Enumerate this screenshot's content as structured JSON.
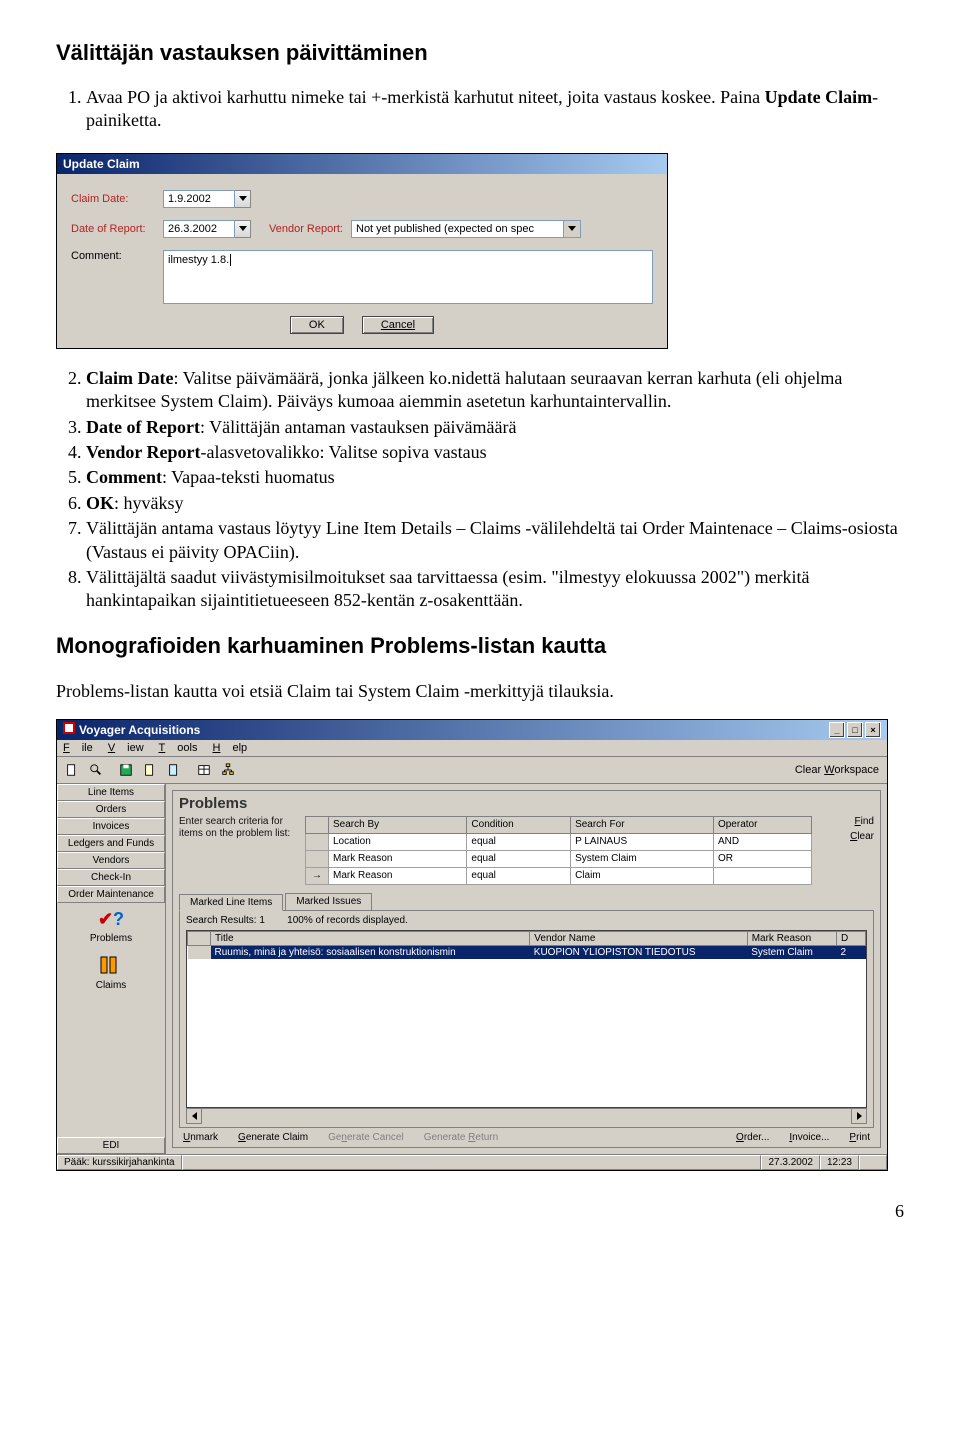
{
  "doc": {
    "heading1": "Välittäjän vastauksen päivittäminen",
    "intro1a": "Avaa PO ja aktivoi karhuttu nimeke tai +-merkistä karhutut niteet, joita vastaus koskee. Paina ",
    "intro1b": "Update Claim",
    "intro1c": "-painiketta.",
    "li2a": "Claim Date",
    "li2b": ": Valitse päivämäärä, jonka jälkeen ko.nidettä halutaan seuraavan kerran karhuta (eli ohjelma merkitsee System Claim). Päiväys kumoaa aiemmin asetetun karhuntaintervallin.",
    "li3a": "Date of Report",
    "li3b": ": Välittäjän antaman vastauksen päivämäärä",
    "li4a": "Vendor Report",
    "li4b": "-alasvetovalikko: Valitse sopiva vastaus",
    "li5a": "Comment",
    "li5b": ": Vapaa-teksti huomatus",
    "li6a": "OK",
    "li6b": ": hyväksy",
    "li7": "Välittäjän antama vastaus löytyy Line Item Details – Claims -välilehdeltä tai Order Maintenace – Claims-osiosta (Vastaus ei päivity OPACiin).",
    "li8": "Välittäjältä saadut viivästymisilmoitukset saa tarvittaessa (esim. \"ilmestyy elokuussa 2002\") merkitä hankintapaikan sijaintitietueeseen 852-kentän z-osakenttään.",
    "heading2": "Monografioiden karhuaminen Problems-listan kautta",
    "para2": "Problems-listan kautta voi etsiä Claim tai System Claim -merkittyjä tilauksia.",
    "page_number": "6"
  },
  "shot1": {
    "title": "Update Claim",
    "labels": {
      "claim_date": "Claim Date:",
      "date_of_report": "Date of Report:",
      "vendor_report": "Vendor Report:",
      "comment": "Comment:"
    },
    "values": {
      "claim_date": "1.9.2002",
      "date_of_report": "26.3.2002",
      "vendor_report": "Not yet published (expected on spec",
      "comment": "ilmestyy 1.8."
    },
    "buttons": {
      "ok": "OK",
      "cancel": "Cancel"
    }
  },
  "shot2": {
    "title": "Voyager Acquisitions",
    "menu": [
      "File",
      "View",
      "Tools",
      "Help"
    ],
    "clear_workspace": "Clear Workspace",
    "sidebar": {
      "buttons": [
        "Line Items",
        "Orders",
        "Invoices",
        "Ledgers and Funds",
        "Vendors",
        "Check-In",
        "Order Maintenance"
      ],
      "icons": [
        {
          "name": "problems-icon",
          "label": "Problems"
        },
        {
          "name": "claims-icon",
          "label": "Claims"
        }
      ],
      "edi": "EDI"
    },
    "panel": {
      "title": "Problems",
      "hint": "Enter search criteria for items on the problem list:",
      "headers": [
        "Search By",
        "Condition",
        "Search For",
        "Operator"
      ],
      "rows": [
        {
          "by": "Location",
          "cond": "equal",
          "for": "P LAINAUS",
          "op": "AND"
        },
        {
          "by": "Mark Reason",
          "cond": "equal",
          "for": "System Claim",
          "op": "OR"
        },
        {
          "by": "Mark Reason",
          "cond": "equal",
          "for": "Claim",
          "op": ""
        }
      ],
      "find": "Find",
      "clear": "Clear",
      "tabs": [
        "Marked Line Items",
        "Marked Issues"
      ],
      "results_status_a": "Search Results:  1",
      "results_status_b": "100% of records displayed.",
      "result_headers": [
        "Title",
        "Vendor Name",
        "Mark Reason",
        "D"
      ],
      "result_row": {
        "title": "Ruumis, minä ja yhteisö: sosiaalisen konstruktionismin",
        "vendor": "KUOPION YLIOPISTON TIEDOTUS",
        "reason": "System Claim",
        "d": "2"
      }
    },
    "bottom": {
      "links": [
        "Unmark",
        "Generate Claim",
        "Generate Cancel",
        "Generate Return",
        "Order...",
        "Invoice...",
        "Print"
      ]
    },
    "status": {
      "label": "Pääk: kurssikirjahankinta",
      "date": "27.3.2002",
      "time": "12:23"
    }
  }
}
